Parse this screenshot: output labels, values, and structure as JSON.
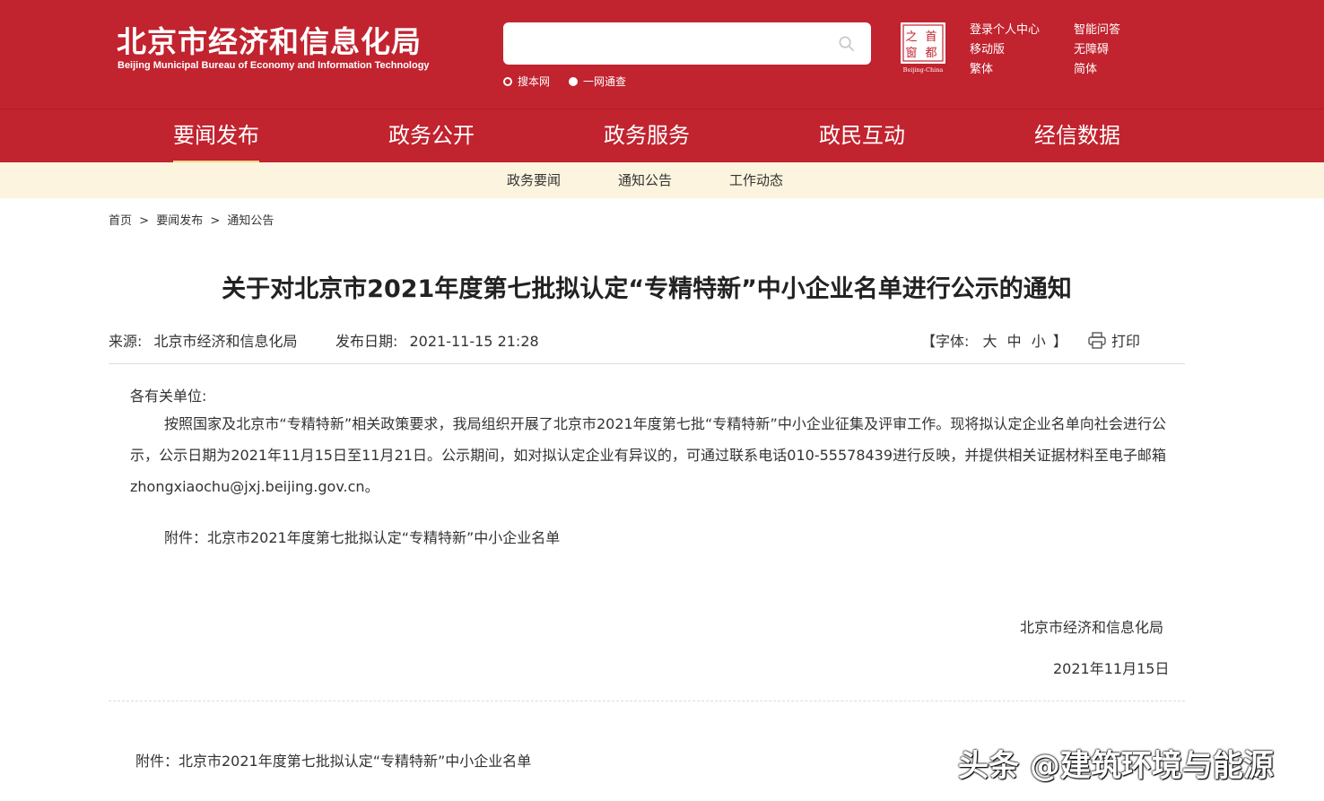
{
  "header": {
    "logo_cn": "北京市经济和信息化局",
    "logo_en": "Beijing Municipal Bureau of Economy and Information Technology",
    "search": {
      "placeholder": ""
    },
    "scope": [
      "搜本网",
      "一网通查"
    ],
    "emblem": {
      "chars": [
        "之",
        "首",
        "窗",
        "都"
      ],
      "caption": "Beijing-China"
    },
    "links_col1": [
      "登录个人中心",
      "移动版",
      "繁体"
    ],
    "links_col2": [
      "智能问答",
      "无障碍",
      "简体"
    ]
  },
  "nav": {
    "items": [
      "要闻发布",
      "政务公开",
      "政务服务",
      "政民互动",
      "经信数据"
    ],
    "active": "要闻发布"
  },
  "subnav": {
    "items": [
      "政务要闻",
      "通知公告",
      "工作动态"
    ]
  },
  "breadcrumb": {
    "items": [
      "首页",
      "要闻发布",
      "通知公告"
    ],
    "separator": ">"
  },
  "article": {
    "title": "关于对北京市2021年度第七批拟认定“专精特新”中小企业名单进行公示的通知",
    "source_label": "来源:",
    "source": "北京市经济和信息化局",
    "date_label": "发布日期:",
    "date": "2021-11-15 21:28",
    "font_label_open": "【字体:",
    "font_sizes": [
      "大",
      "中",
      "小"
    ],
    "font_label_close": "】",
    "print_label": "打印",
    "salutation": "各有关单位:",
    "paragraph": "按照国家及北京市“专精特新”相关政策要求，我局组织开展了北京市2021年度第七批“专精特新”中小企业征集及评审工作。现将拟认定企业名单向社会进行公示，公示日期为2021年11月15日至11月21日。公示期间，如对拟认定企业有异议的，可通过联系电话010-55578439进行反映，并提供相关证据材料至电子邮箱zhongxiaochu@jxj.beijing.gov.cn。",
    "attachment_inline": "附件：北京市2021年度第七批拟认定“专精特新”中小企业名单",
    "signature": "北京市经济和信息化局",
    "sign_date": "2021年11月15日",
    "attachment_bottom": "附件：北京市2021年度第七批拟认定“专精特新”中小企业名单"
  },
  "watermark": "头条 @建筑环境与能源"
}
